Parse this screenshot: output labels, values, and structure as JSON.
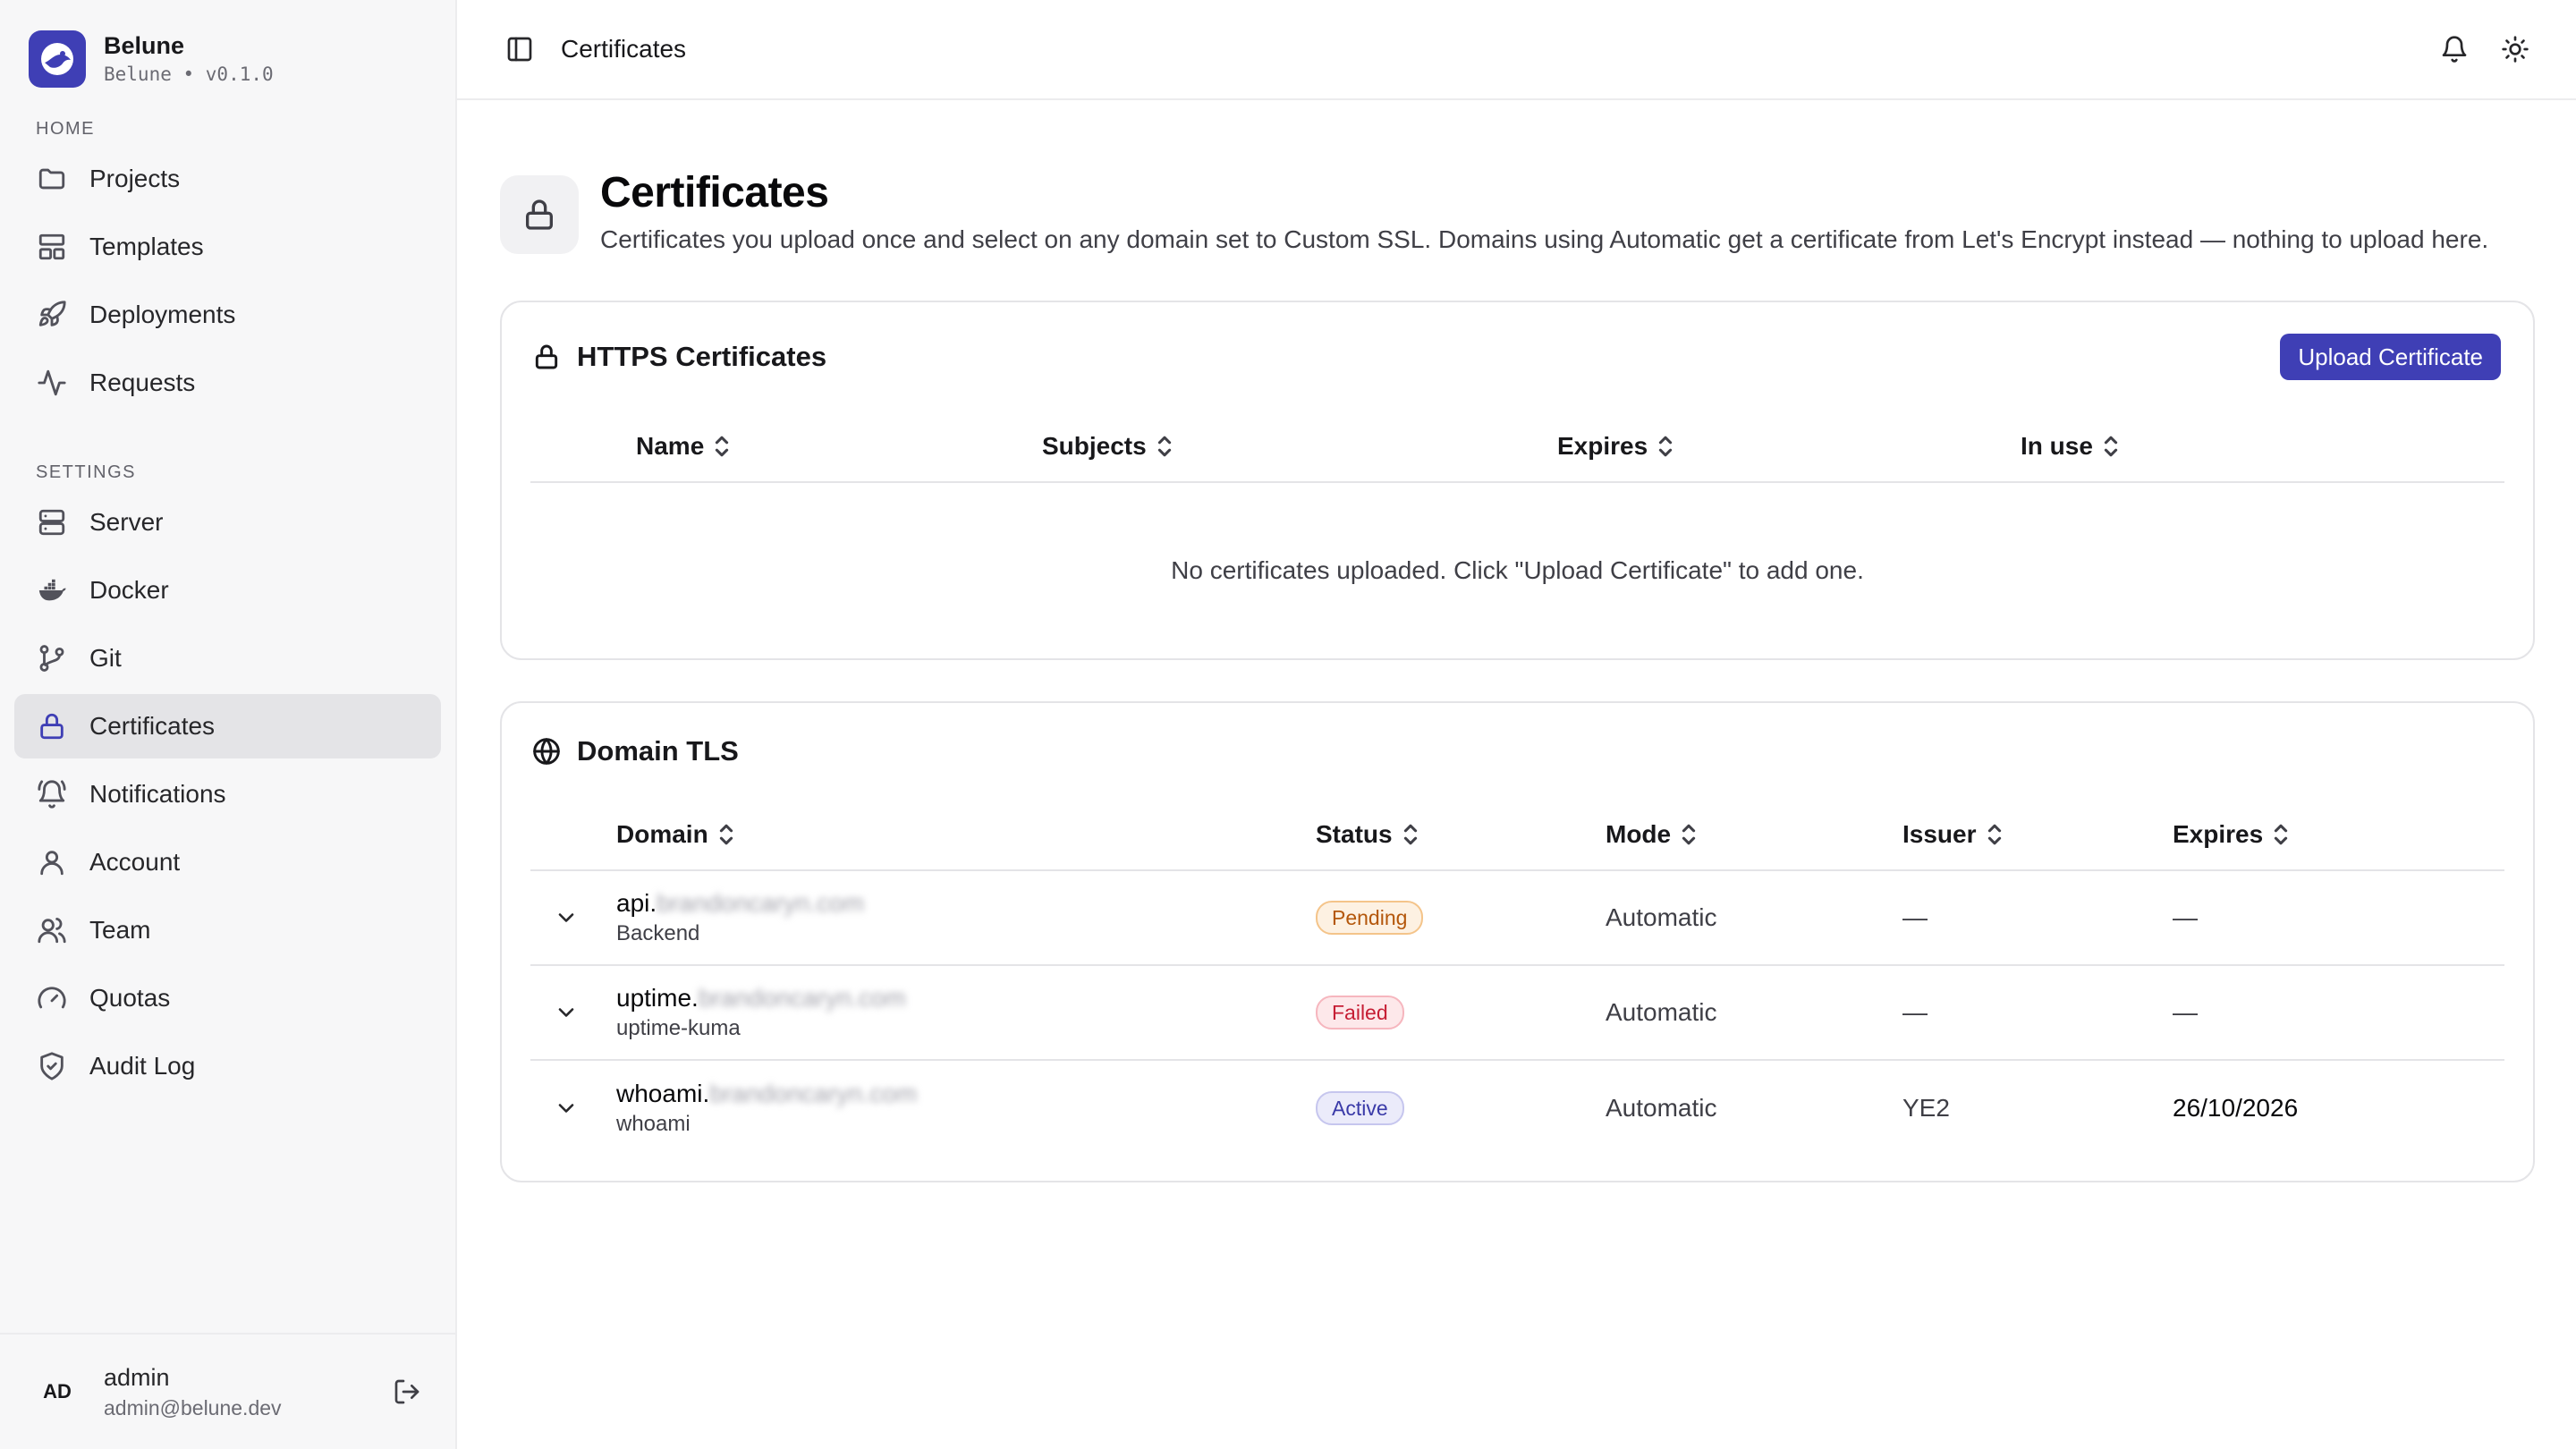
{
  "brand": {
    "name": "Belune",
    "subtitle": "Belune • v0.1.0"
  },
  "sidebar": {
    "sections": [
      {
        "label": "HOME",
        "items": [
          {
            "label": "Projects",
            "icon": "folder-icon"
          },
          {
            "label": "Templates",
            "icon": "layout-icon"
          },
          {
            "label": "Deployments",
            "icon": "rocket-icon"
          },
          {
            "label": "Requests",
            "icon": "activity-icon"
          }
        ]
      },
      {
        "label": "SETTINGS",
        "items": [
          {
            "label": "Server",
            "icon": "server-icon"
          },
          {
            "label": "Docker",
            "icon": "docker-icon"
          },
          {
            "label": "Git",
            "icon": "git-branch-icon"
          },
          {
            "label": "Certificates",
            "icon": "lock-icon",
            "active": true
          },
          {
            "label": "Notifications",
            "icon": "bell-ring-icon"
          },
          {
            "label": "Account",
            "icon": "user-icon"
          },
          {
            "label": "Team",
            "icon": "users-icon"
          },
          {
            "label": "Quotas",
            "icon": "gauge-icon"
          },
          {
            "label": "Audit Log",
            "icon": "shield-check-icon"
          }
        ]
      }
    ]
  },
  "user": {
    "initials": "AD",
    "name": "admin",
    "email": "admin@belune.dev"
  },
  "topbar": {
    "title": "Certificates"
  },
  "page": {
    "title": "Certificates",
    "description": "Certificates you upload once and select on any domain set to Custom SSL. Domains using Automatic get a certificate from Let's Encrypt instead — nothing to upload here."
  },
  "https_card": {
    "title": "HTTPS Certificates",
    "upload_label": "Upload Certificate",
    "columns": [
      "Name",
      "Subjects",
      "Expires",
      "In use"
    ],
    "empty_text": "No certificates uploaded. Click \"Upload Certificate\" to add one."
  },
  "tls_card": {
    "title": "Domain TLS",
    "columns": [
      "Domain",
      "Status",
      "Mode",
      "Issuer",
      "Expires"
    ],
    "rows": [
      {
        "prefix": "api.",
        "host": "brandoncaryn.com",
        "service": "Backend",
        "status": "Pending",
        "status_kind": "pending",
        "mode": "Automatic",
        "issuer": "—",
        "expires": "—"
      },
      {
        "prefix": "uptime.",
        "host": "brandoncaryn.com",
        "service": "uptime-kuma",
        "status": "Failed",
        "status_kind": "failed",
        "mode": "Automatic",
        "issuer": "—",
        "expires": "—"
      },
      {
        "prefix": "whoami.",
        "host": "brandoncaryn.com",
        "service": "whoami",
        "status": "Active",
        "status_kind": "active",
        "mode": "Automatic",
        "issuer": "YE2",
        "expires": "26/10/2026"
      }
    ]
  },
  "colors": {
    "accent": "#3f3fb5",
    "sidebar_bg": "#f7f7f8",
    "border": "#e4e4e7"
  }
}
